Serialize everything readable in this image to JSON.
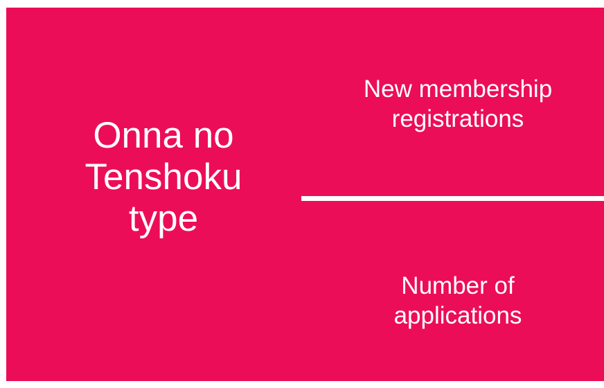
{
  "slide": {
    "title_lines": [
      "Onna no",
      "Tenshoku",
      "type"
    ],
    "metrics": [
      {
        "lines": [
          "New membership",
          "registrations"
        ]
      },
      {
        "lines": [
          "Number of",
          "applications"
        ]
      }
    ]
  },
  "colors": {
    "background": "#ec0d58",
    "text": "#ffffff",
    "divider": "#ffffff"
  }
}
